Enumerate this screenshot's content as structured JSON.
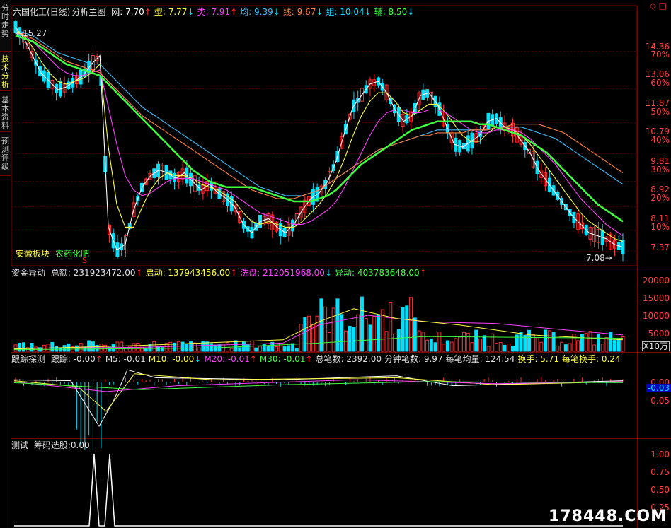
{
  "sidebar": {
    "tabs": [
      "分时走势",
      "技术分析",
      "基本资料",
      "预测评级"
    ]
  },
  "main": {
    "title": "六国化工(日线)",
    "subtitle": "分析主图",
    "indicators": [
      {
        "label": "网:",
        "value": "7.70",
        "dir": "up",
        "color": "#ffffff"
      },
      {
        "label": "型:",
        "value": "7.77",
        "dir": "dn",
        "color": "#ffff40"
      },
      {
        "label": "类:",
        "value": "7.91",
        "dir": "up",
        "color": "#ff40ff"
      },
      {
        "label": "均:",
        "value": "9.39",
        "dir": "dn",
        "color": "#40c0ff"
      },
      {
        "label": "线:",
        "value": "9.67",
        "dir": "dn",
        "color": "#ff8040"
      },
      {
        "label": "组:",
        "value": "10.04",
        "dir": "dn",
        "color": "#00e0ff"
      },
      {
        "label": "辅:",
        "value": "8.50",
        "dir": "dn",
        "color": "#40ff40"
      }
    ],
    "price_axis": [
      "14.36",
      "13.06",
      "11.87",
      "10.79",
      "9.81",
      "8.92",
      "8.11",
      "7.37"
    ],
    "pct_axis": [
      "70%",
      "60%",
      "50%",
      "40%",
      "30%",
      "20%",
      "10%"
    ],
    "high_mark": "15.27",
    "low_mark": "7.08",
    "sector_label": "安徽板块",
    "industry_label": "农药化肥",
    "signal_mark": "S",
    "top_buttons": "◇ □"
  },
  "fund": {
    "title": "资金异动",
    "items": [
      {
        "label": "总额:",
        "value": "231923472.00",
        "dir": "up",
        "color": "#e0e0e0"
      },
      {
        "label": "启动:",
        "value": "137943456.00",
        "dir": "up",
        "color": "#ffff40"
      },
      {
        "label": "洗盘:",
        "value": "212051968.00",
        "dir": "dn",
        "color": "#ff40ff"
      },
      {
        "label": "异动:",
        "value": "403783648.00",
        "dir": "up",
        "color": "#40ff40"
      }
    ],
    "axis": [
      "20000",
      "15000",
      "10000",
      "5000"
    ],
    "unit": "X10万"
  },
  "track": {
    "title": "跟踪探测",
    "items": [
      {
        "label": "跟踪:",
        "value": "-0.00",
        "dir": "up",
        "color": "#e0e0e0"
      },
      {
        "label": "M5:",
        "value": "-0.01",
        "dir": "",
        "color": "#e0e0e0"
      },
      {
        "label": "M10:",
        "value": "-0.00",
        "dir": "dn",
        "color": "#ffff40"
      },
      {
        "label": "M20:",
        "value": "-0.01",
        "dir": "up",
        "color": "#ff40ff"
      },
      {
        "label": "M30:",
        "value": "-0.01",
        "dir": "up",
        "color": "#40ff40"
      },
      {
        "label": "总笔数:",
        "value": "2392.00",
        "dir": "",
        "color": "#e0e0e0"
      },
      {
        "label": "分钟笔数:",
        "value": "9.97",
        "dir": "",
        "color": "#e0e0e0"
      },
      {
        "label": "每笔均量:",
        "value": "124.54",
        "dir": "",
        "color": "#e0e0e0"
      },
      {
        "label": "换手:",
        "value": "5.71",
        "dir": "",
        "color": "#ffff40"
      },
      {
        "label": "每笔换手:",
        "value": "0.24",
        "dir": "",
        "color": "#ffff40"
      }
    ],
    "axis": [
      "0.00",
      "-0.05"
    ],
    "current": "-0.03"
  },
  "test": {
    "title": "测试",
    "label": "筹码选股:",
    "value": "0.00",
    "axis": [
      "1.00",
      "0.75",
      "0.50",
      "0.25"
    ]
  },
  "watermark": "178448.COM",
  "colors": {
    "up": "#ff3030",
    "down": "#00e0ff",
    "grid": "#800000",
    "ma_green": "#40ff40"
  },
  "chart_data": {
    "type": "candlestick",
    "price_range": [
      7.0,
      15.4
    ],
    "series": [
      {
        "color": "#ffffff",
        "values": [
          15.2,
          14.8,
          14.2,
          13.6,
          13.3,
          13.0,
          13.1,
          13.3,
          13.5,
          13.9,
          14.2,
          8.2,
          7.4,
          7.6,
          8.8,
          9.6,
          10.0,
          10.2,
          10.1,
          9.9,
          10.1,
          9.8,
          9.5,
          9.7,
          9.4,
          9.2,
          8.9,
          8.3,
          8.0,
          8.4,
          8.5,
          8.2,
          8.0,
          8.3,
          8.8,
          9.2,
          9.4,
          9.8,
          10.5,
          11.5,
          12.4,
          12.8,
          13.2,
          13.3,
          12.9,
          12.3,
          11.9,
          12.1,
          12.8,
          12.9,
          12.5,
          11.8,
          11.1,
          11.0,
          11.2,
          11.4,
          11.9,
          12.0,
          11.7,
          11.6,
          11.2,
          10.8,
          10.2,
          9.8,
          9.4,
          9.0,
          8.6,
          8.3,
          8.0,
          7.9,
          7.8,
          7.6,
          7.5
        ]
      },
      {
        "color": "#ffff40",
        "values": [
          15.1,
          14.9,
          14.5,
          14.0,
          13.6,
          13.3,
          13.2,
          13.3,
          13.4,
          13.6,
          13.9,
          11.0,
          9.0,
          8.2,
          8.2,
          8.9,
          9.5,
          9.9,
          10.1,
          10.0,
          10.0,
          9.9,
          9.7,
          9.6,
          9.5,
          9.3,
          9.1,
          8.7,
          8.4,
          8.3,
          8.4,
          8.3,
          8.2,
          8.2,
          8.4,
          8.7,
          9.0,
          9.4,
          9.9,
          10.6,
          11.4,
          12.1,
          12.6,
          12.9,
          12.9,
          12.6,
          12.2,
          12.1,
          12.3,
          12.5,
          12.5,
          12.2,
          11.8,
          11.4,
          11.2,
          11.2,
          11.5,
          11.7,
          11.7,
          11.6,
          11.4,
          11.1,
          10.7,
          10.3,
          9.9,
          9.5,
          9.1,
          8.7,
          8.4,
          8.2,
          8.0,
          7.8,
          7.7
        ]
      },
      {
        "color": "#ff40ff",
        "values": [
          15.0,
          14.9,
          14.7,
          14.4,
          14.1,
          13.8,
          13.6,
          13.5,
          13.5,
          13.6,
          13.7,
          12.4,
          11.1,
          10.0,
          9.5,
          9.3,
          9.4,
          9.6,
          9.8,
          9.9,
          9.9,
          9.9,
          9.8,
          9.7,
          9.6,
          9.5,
          9.3,
          9.1,
          8.9,
          8.7,
          8.6,
          8.5,
          8.4,
          8.3,
          8.3,
          8.4,
          8.6,
          8.8,
          9.1,
          9.6,
          10.2,
          10.8,
          11.4,
          11.9,
          12.2,
          12.3,
          12.3,
          12.2,
          12.2,
          12.3,
          12.3,
          12.2,
          12.0,
          11.8,
          11.6,
          11.5,
          11.5,
          11.6,
          11.6,
          11.6,
          11.5,
          11.3,
          11.0,
          10.7,
          10.4,
          10.0,
          9.6,
          9.2,
          8.9,
          8.6,
          8.3,
          8.1,
          7.9
        ]
      },
      {
        "color": "#40c0ff",
        "values": [
          15.1,
          15.0,
          14.9,
          14.7,
          14.5,
          14.3,
          14.2,
          14.1,
          14.0,
          13.9,
          13.9,
          13.6,
          13.3,
          13.0,
          12.7,
          12.4,
          12.2,
          12.0,
          11.8,
          11.6,
          11.4,
          11.2,
          11.0,
          10.8,
          10.6,
          10.4,
          10.2,
          10.0,
          9.8,
          9.6,
          9.5,
          9.4,
          9.3,
          9.3,
          9.3,
          9.4,
          9.5,
          9.7,
          9.9,
          10.1,
          10.3,
          10.5,
          10.7,
          10.9,
          11.0,
          11.1,
          11.2,
          11.3,
          11.4,
          11.5,
          11.6,
          11.6,
          11.6,
          11.6,
          11.6,
          11.6,
          11.6,
          11.7,
          11.7,
          11.7,
          11.7,
          11.6,
          11.5,
          11.4,
          11.3,
          11.1,
          10.9,
          10.7,
          10.5,
          10.3,
          10.1,
          9.9,
          9.7
        ]
      },
      {
        "color": "#ff8040",
        "values": [
          15.0,
          14.9,
          14.8,
          14.6,
          14.4,
          14.2,
          14.0,
          13.9,
          13.8,
          13.7,
          13.6,
          13.3,
          13.0,
          12.7,
          12.4,
          12.1,
          11.9,
          11.7,
          11.5,
          11.3,
          11.1,
          10.9,
          10.7,
          10.5,
          10.3,
          10.1,
          9.9,
          9.7,
          9.5,
          9.4,
          9.3,
          9.2,
          9.2,
          9.2,
          9.3,
          9.4,
          9.5,
          9.7,
          9.9,
          10.1,
          10.3,
          10.5,
          10.7,
          10.9,
          11.0,
          11.1,
          11.2,
          11.3,
          11.4,
          11.4,
          11.5,
          11.5,
          11.5,
          11.5,
          11.6,
          11.6,
          11.6,
          11.7,
          11.7,
          11.8,
          11.8,
          11.8,
          11.8,
          11.7,
          11.6,
          11.5,
          11.3,
          11.1,
          10.9,
          10.7,
          10.5,
          10.3,
          10.1
        ]
      },
      {
        "color": "#40ff40",
        "values": [
          14.9,
          14.8,
          14.7,
          14.5,
          14.3,
          14.1,
          13.9,
          13.8,
          13.7,
          13.6,
          13.5,
          13.2,
          12.9,
          12.6,
          12.3,
          12.0,
          11.7,
          11.4,
          11.1,
          10.8,
          10.5,
          10.2,
          10.0,
          9.8,
          9.7,
          9.6,
          9.6,
          9.6,
          9.6,
          9.5,
          9.4,
          9.3,
          9.2,
          9.1,
          9.1,
          9.1,
          9.2,
          9.3,
          9.5,
          9.8,
          10.1,
          10.4,
          10.6,
          10.8,
          11.0,
          11.2,
          11.4,
          11.6,
          11.7,
          11.8,
          11.9,
          11.9,
          11.9,
          11.9,
          11.9,
          11.8,
          11.8,
          11.7,
          11.6,
          11.5,
          11.4,
          11.2,
          11.0,
          10.8,
          10.5,
          10.2,
          9.9,
          9.6,
          9.3,
          9.0,
          8.8,
          8.6,
          8.4
        ]
      }
    ]
  }
}
